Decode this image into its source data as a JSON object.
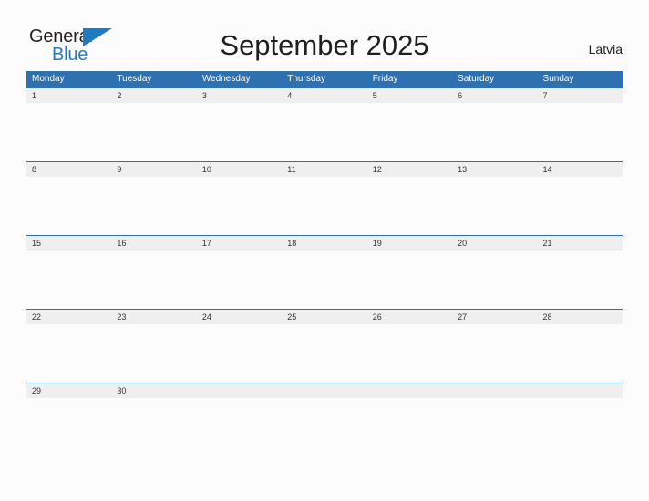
{
  "brand": {
    "name_part1": "General",
    "name_part2": "Blue",
    "triangle_icon": "blue-triangle-icon",
    "accent_color": "#1f7bc1",
    "text_color": "#231f20"
  },
  "header": {
    "title": "September 2025",
    "country": "Latvia"
  },
  "calendar": {
    "header_color": "#2e70b0",
    "band_color": "#efefef",
    "weekday_headers": [
      "Monday",
      "Tuesday",
      "Wednesday",
      "Thursday",
      "Friday",
      "Saturday",
      "Sunday"
    ],
    "weeks": [
      {
        "days": [
          "1",
          "2",
          "3",
          "4",
          "5",
          "6",
          "7"
        ]
      },
      {
        "days": [
          "8",
          "9",
          "10",
          "11",
          "12",
          "13",
          "14"
        ]
      },
      {
        "days": [
          "15",
          "16",
          "17",
          "18",
          "19",
          "20",
          "21"
        ]
      },
      {
        "days": [
          "22",
          "23",
          "24",
          "25",
          "26",
          "27",
          "28"
        ]
      },
      {
        "days": [
          "29",
          "30",
          "",
          "",
          "",
          "",
          ""
        ]
      }
    ]
  }
}
